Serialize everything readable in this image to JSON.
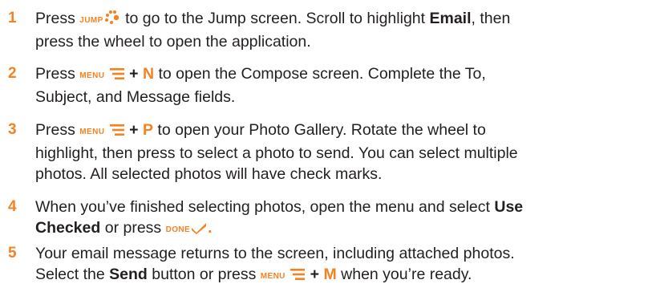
{
  "steps": [
    {
      "number": "1",
      "t1": "Press",
      "key": "JUMP",
      "t2": "to go to the Jump screen. Scroll to highlight",
      "bold1": "Email",
      "t3": ", then",
      "t4": "press the wheel to open the application."
    },
    {
      "number": "2",
      "t1": "Press",
      "key": "MENU",
      "plus": "+",
      "letter": "N",
      "t2": "to open the Compose screen. Complete the To,",
      "t3": "Subject, and Message fields."
    },
    {
      "number": "3",
      "t1": "Press",
      "key": "MENU",
      "plus": "+",
      "letter": "P",
      "t2": "to open your Photo Gallery. Rotate the wheel to",
      "t3": "highlight, then press to select a photo to send. You can select multiple",
      "t4": "photos. All selected photos will have check marks."
    },
    {
      "number": "4",
      "t1": "When you’ve finished selecting photos, open the menu and select",
      "bold1": "Use",
      "bold2": "Checked",
      "t2": "or press",
      "key": "DONE",
      "t3": "."
    },
    {
      "number": "5",
      "t1": "Your email message returns to the screen, including attached photos.",
      "t2": "Select the",
      "bold1": "Send",
      "t3": "button or press",
      "key": "MENU",
      "plus": "+",
      "letter": "M",
      "t4": "when you’re ready."
    }
  ]
}
